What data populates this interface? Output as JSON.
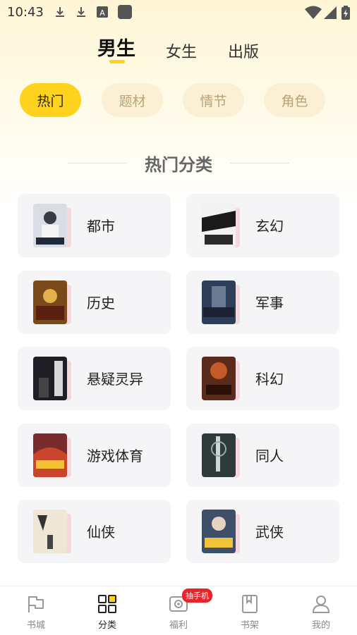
{
  "status_bar": {
    "time": "10:43",
    "icons": [
      "download-icon",
      "download-icon",
      "font-app-icon",
      "app-square-icon"
    ],
    "right_icons": [
      "wifi-icon",
      "signal-icon",
      "battery-charging-icon"
    ]
  },
  "gender_tabs": [
    {
      "label": "男生",
      "active": true
    },
    {
      "label": "女生",
      "active": false
    },
    {
      "label": "出版",
      "active": false
    }
  ],
  "filters": [
    {
      "label": "热门",
      "active": true
    },
    {
      "label": "题材",
      "active": false
    },
    {
      "label": "情节",
      "active": false
    },
    {
      "label": "角色",
      "active": false
    }
  ],
  "section_title": "热门分类",
  "categories": [
    {
      "label": "都市",
      "cover_color": "#d9dde4"
    },
    {
      "label": "玄幻",
      "cover_color": "#2b2b2b"
    },
    {
      "label": "历史",
      "cover_color": "#7a4a1a"
    },
    {
      "label": "军事",
      "cover_color": "#2c3e5a"
    },
    {
      "label": "悬疑灵异",
      "cover_color": "#1e1e24"
    },
    {
      "label": "科幻",
      "cover_color": "#5a2a1a"
    },
    {
      "label": "游戏体育",
      "cover_color": "#7a2b2b"
    },
    {
      "label": "同人",
      "cover_color": "#2f3a3a"
    },
    {
      "label": "仙侠",
      "cover_color": "#efe6d6"
    },
    {
      "label": "武侠",
      "cover_color": "#3e4f6a"
    }
  ],
  "bottom_nav": [
    {
      "label": "书城",
      "icon": "bookstore-flag-icon",
      "active": false
    },
    {
      "label": "分类",
      "icon": "category-grid-icon",
      "active": true
    },
    {
      "label": "福利",
      "icon": "welfare-camera-icon",
      "active": false,
      "badge": "抽手机"
    },
    {
      "label": "书架",
      "icon": "bookshelf-book-icon",
      "active": false
    },
    {
      "label": "我的",
      "icon": "profile-person-icon",
      "active": false
    }
  ],
  "colors": {
    "accent": "#ffd21e",
    "badge": "#e8242b"
  }
}
